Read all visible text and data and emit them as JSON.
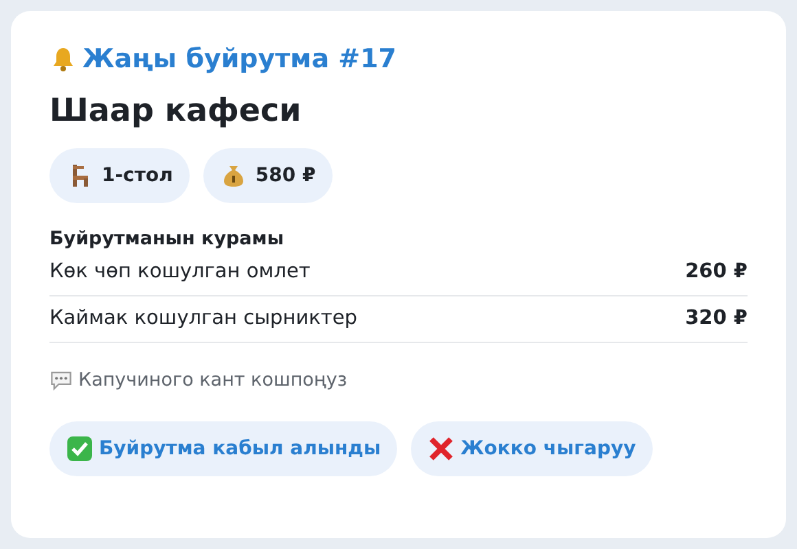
{
  "title": "Жаңы буйрутма #17",
  "venue": "Шаар кафеси",
  "chips": [
    {
      "kind": "table",
      "label": "1-стол"
    },
    {
      "kind": "amount",
      "label": "580 ₽"
    }
  ],
  "items_heading": "Буйрутманын курамы",
  "items": [
    {
      "name": "Көк чөп кошулган омлет",
      "price": "260 ₽"
    },
    {
      "name": "Каймак кошулган сырниктер",
      "price": "320 ₽"
    }
  ],
  "note": "Капучиного кант кошпоңуз",
  "actions": [
    {
      "kind": "accept",
      "label": "Буйрутма кабыл алынды"
    },
    {
      "kind": "cancel",
      "label": "Жокко чыгаруу"
    }
  ]
}
